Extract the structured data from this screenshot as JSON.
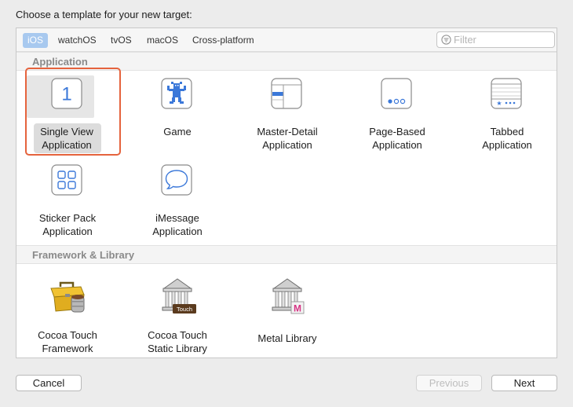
{
  "window": {
    "heading": "Choose a template for your new target:"
  },
  "platform_tabs": [
    {
      "label": "iOS",
      "selected": true
    },
    {
      "label": "watchOS",
      "selected": false
    },
    {
      "label": "tvOS",
      "selected": false
    },
    {
      "label": "macOS",
      "selected": false
    },
    {
      "label": "Cross-platform",
      "selected": false
    }
  ],
  "filter": {
    "placeholder": "Filter",
    "value": ""
  },
  "sections": [
    {
      "title": "Application",
      "templates": [
        {
          "line1": "Single View",
          "line2": "Application",
          "icon": "single-view-app-icon",
          "selected": true
        },
        {
          "line1": "Game",
          "line2": "",
          "icon": "game-app-icon",
          "selected": false
        },
        {
          "line1": "Master-Detail",
          "line2": "Application",
          "icon": "master-detail-app-icon",
          "selected": false
        },
        {
          "line1": "Page-Based",
          "line2": "Application",
          "icon": "page-based-app-icon",
          "selected": false
        },
        {
          "line1": "Tabbed",
          "line2": "Application",
          "icon": "tabbed-app-icon",
          "selected": false
        },
        {
          "line1": "Sticker Pack",
          "line2": "Application",
          "icon": "sticker-pack-app-icon",
          "selected": false
        },
        {
          "line1": "iMessage",
          "line2": "Application",
          "icon": "imessage-app-icon",
          "selected": false
        }
      ]
    },
    {
      "title": "Framework & Library",
      "templates": [
        {
          "line1": "Cocoa Touch",
          "line2": "Framework",
          "icon": "toolbox-icon",
          "selected": false
        },
        {
          "line1": "Cocoa Touch",
          "line2": "Static Library",
          "icon": "static-library-icon",
          "selected": false
        },
        {
          "line1": "Metal Library",
          "line2": "",
          "icon": "metal-library-icon",
          "selected": false
        }
      ]
    }
  ],
  "icon_badges": {
    "single_view_digit": "1",
    "static_library_badge": "Touch",
    "metal_badge": "M"
  },
  "buttons": {
    "cancel": "Cancel",
    "previous": "Previous",
    "next": "Next"
  },
  "colors": {
    "selected_tab": "#a8c9ef",
    "selection_frame": "#e5633d",
    "icon_blue": "#3b78d9",
    "section_label": "#8a8a8a"
  }
}
